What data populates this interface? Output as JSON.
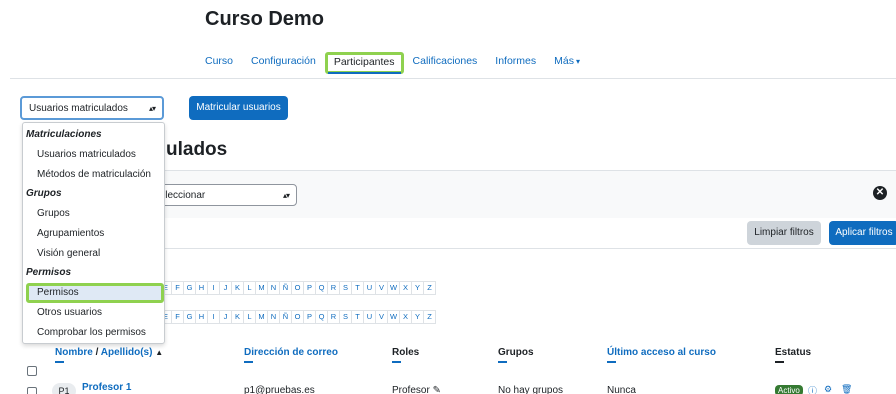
{
  "course": {
    "title": "Curso Demo"
  },
  "nav": {
    "items": [
      "Curso",
      "Configuración",
      "Participantes",
      "Calificaciones",
      "Informes",
      "Más"
    ],
    "active": "Participantes"
  },
  "enrol_select": {
    "value": "Usuarios matriculados"
  },
  "enrol_button": {
    "label": "Matricular usuarios"
  },
  "page_heading": {
    "partial_text": "ulados"
  },
  "dropdown": {
    "groups": [
      {
        "label": "Matriculaciones",
        "items": [
          "Usuarios matriculados",
          "Métodos de matriculación"
        ]
      },
      {
        "label": "Grupos",
        "items": [
          "Grupos",
          "Agrupamientos",
          "Visión general"
        ]
      },
      {
        "label": "Permisos",
        "items": [
          "Permisos",
          "Otros usuarios",
          "Comprobar los permisos"
        ]
      }
    ],
    "selected": "Permisos"
  },
  "filters": {
    "select_value": "Seleccionar",
    "clear_label": "Limpiar filtros",
    "apply_label": "Aplicar filtros"
  },
  "letters_first": [
    "E",
    "F",
    "G",
    "H",
    "I",
    "J",
    "K",
    "L",
    "M",
    "N",
    "Ñ",
    "O",
    "P",
    "Q",
    "R",
    "S",
    "T",
    "U",
    "V",
    "W",
    "X",
    "Y",
    "Z"
  ],
  "letters_last": [
    "E",
    "F",
    "G",
    "H",
    "I",
    "J",
    "K",
    "L",
    "M",
    "N",
    "Ñ",
    "O",
    "P",
    "Q",
    "R",
    "S",
    "T",
    "U",
    "V",
    "W",
    "X",
    "Y",
    "Z"
  ],
  "table": {
    "headers": {
      "name": "Nombre",
      "name_sep": " / ",
      "surname": "Apellido(s)",
      "email": "Dirección de correo",
      "roles": "Roles",
      "groups": "Grupos",
      "last_access": "Último acceso al curso",
      "status": "Estatus"
    },
    "rows": [
      {
        "initials": "P1",
        "name": "Profesor 1",
        "email": "p1@pruebas.es",
        "role": "Profesor",
        "groups": "No hay grupos",
        "last_access": "Nunca",
        "status": "Activo"
      }
    ]
  },
  "colors": {
    "accent": "#0f6cbf",
    "highlight": "#8fd14f",
    "active_status": "#357a32"
  }
}
